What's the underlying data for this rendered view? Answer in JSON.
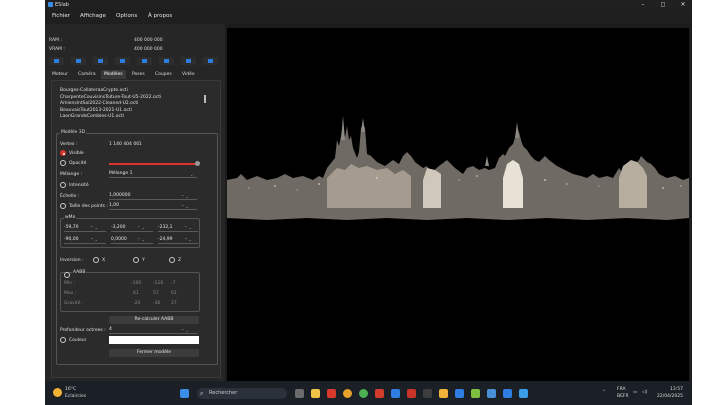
{
  "app": {
    "title": "ESlab"
  },
  "window_controls": {
    "minimize": "–",
    "maximize": "◻",
    "close": "✕"
  },
  "menu": [
    "Fichier",
    "Affichage",
    "Options",
    "À propos"
  ],
  "memory": {
    "ram_label": "RAM :",
    "ram_value": "400 000 000",
    "vram_label": "VRAM :",
    "vram_value": "400 000 000"
  },
  "tabs": [
    "Moteur",
    "Caméra",
    "Modèles",
    "Poses",
    "Coupes",
    "Vidéo"
  ],
  "files": [
    "Bourges-CollateraaCrypte.octi",
    "CharpenteCouvisinsToiture-Tout-U5-2022.octi",
    "AmiensIntSol2022-Cleaned-U2.octi",
    "BeauvaisTout2013-2021-U1.octi",
    "LaonGrandsCombles-U1.octi"
  ],
  "model3d": {
    "title": "Modèle 3D",
    "vertex_label": "Vertex :",
    "vertex_value": "1 140 404 061",
    "visible_label": "Visible",
    "opacity_label": "Opacité",
    "blend_label": "Mélange :",
    "blend_value": "Mélange 1",
    "intensity_label": "Intensité",
    "scale_label": "Échelle :",
    "scale_value": "1,000000",
    "pointsize_label": "Taille des points :",
    "pointsize_value": "1,00",
    "wm_title": "wMo",
    "wm_row1": [
      "-59,70",
      "-3,200",
      "-232,1"
    ],
    "wm_row2": [
      "-90,00",
      "0,0000",
      "-24,99"
    ],
    "inversion_label": "Inversion :",
    "axes": [
      "X",
      "Y",
      "Z"
    ],
    "aabb_title": "AABB",
    "aabb_rows": [
      {
        "label": "Min :",
        "values": [
          "-100",
          "-116",
          "-7"
        ]
      },
      {
        "label": "Max :",
        "values": [
          "61",
          "57",
          "61"
        ]
      },
      {
        "label": "Gravité :",
        "values": [
          "-20",
          "-30",
          "27"
        ]
      }
    ],
    "recalc_button": "Re-calculer AABB",
    "octree_label": "Profondeur octrees :",
    "octree_value": "4",
    "color_label": "Couleur",
    "close_button": "Fermer modèle"
  },
  "accent_color": "#d9342b",
  "taskbar": {
    "weather_temp": "16°C",
    "weather_desc": "Eclaircies",
    "search_placeholder": "Rechercher",
    "lang_top": "FRA",
    "lang_bottom": "BEFR",
    "time": "13:57",
    "date": "22/04/2025"
  }
}
